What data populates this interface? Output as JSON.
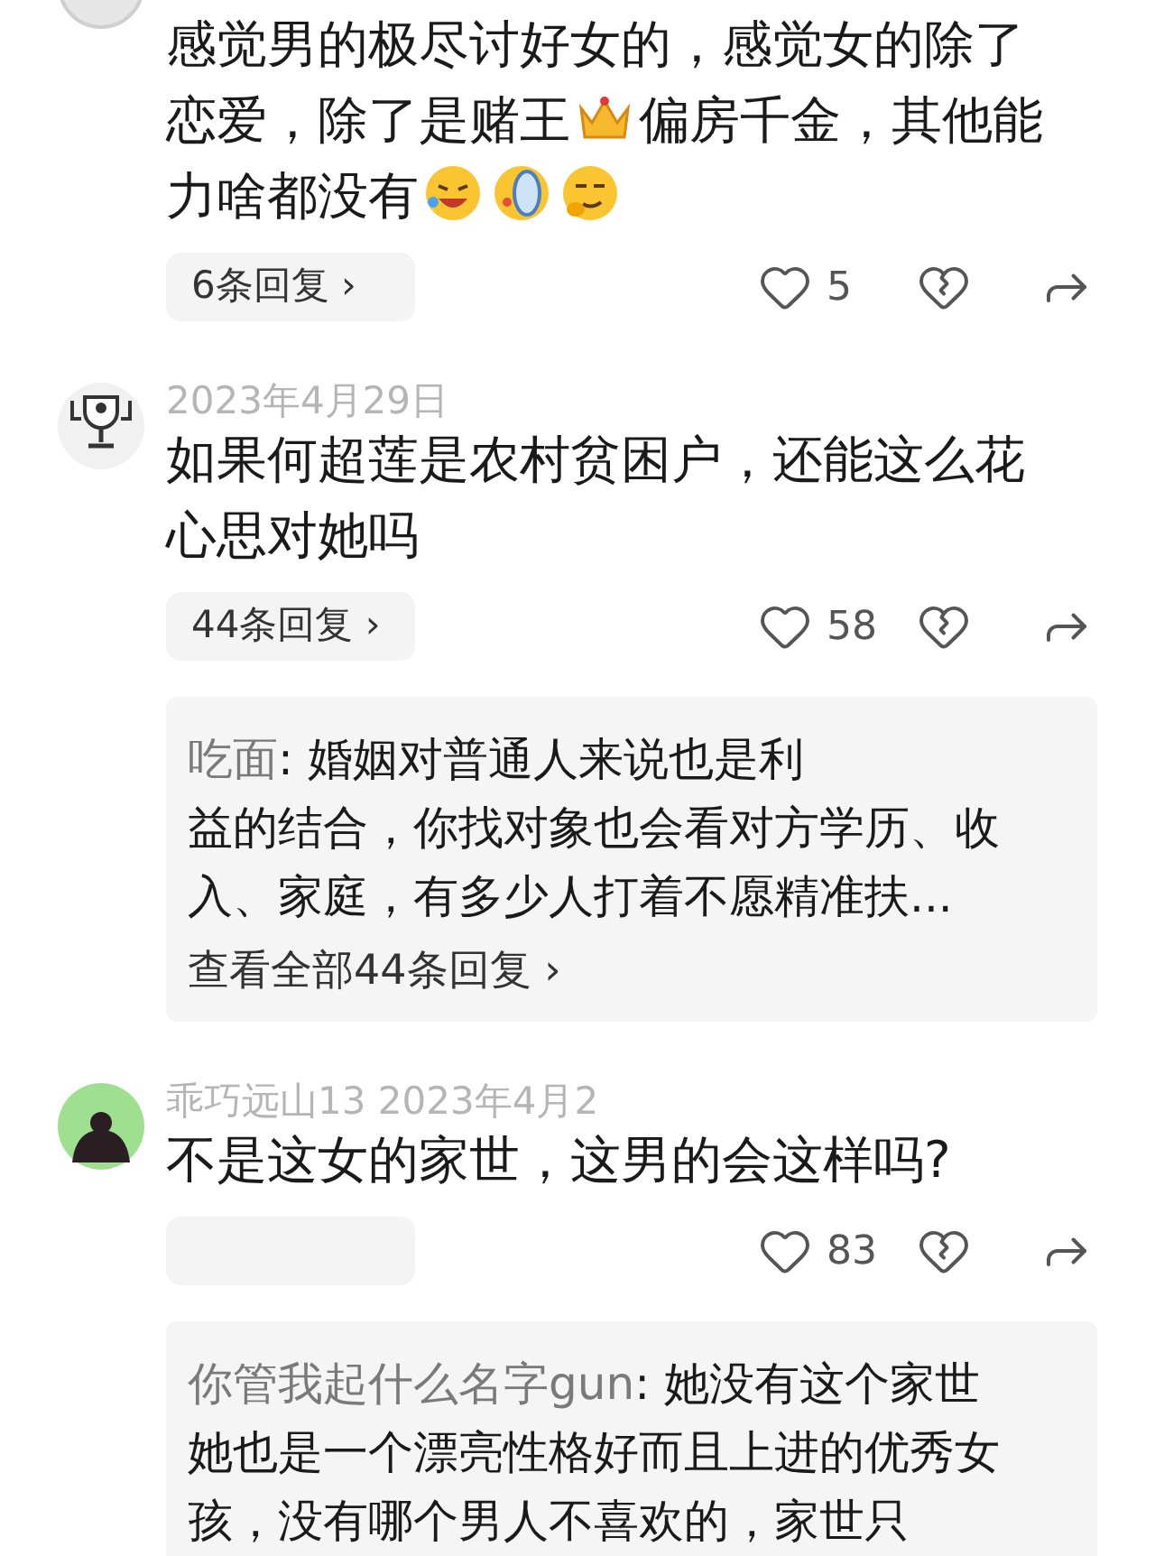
{
  "comments": [
    {
      "avatar": {
        "kind": "plain"
      },
      "lines": [
        [
          {
            "kind": "text",
            "text": "感觉男的极尽讨好女的，感觉女的除了"
          }
        ],
        [
          {
            "kind": "text",
            "text": "恋爱，除了是赌王"
          },
          {
            "kind": "crown"
          },
          {
            "kind": "text",
            "text": "偏房千金，其他能"
          }
        ],
        [
          {
            "kind": "text",
            "text": "力啥都没有"
          },
          {
            "kind": "laugh"
          },
          {
            "kind": "slipper"
          },
          {
            "kind": "smug"
          }
        ]
      ],
      "replies_label": "6条回复 ›",
      "likes": "5"
    },
    {
      "avatar": {
        "kind": "trophy"
      },
      "header": "2023年4月29日",
      "lines": [
        [
          {
            "kind": "text",
            "text": "如果何超莲是农村贫困户，还能这么花"
          }
        ],
        [
          {
            "kind": "text",
            "text": "心思对她吗"
          }
        ]
      ],
      "replies_label": "44条回复 ›",
      "likes": "58",
      "reply": {
        "author": "吃面",
        "lines": [
          ": 婚姻对普通人来说也是利",
          "益的结合，你找对象也会看对方学历、收",
          "入、家庭，有多少人打着不愿精准扶..."
        ],
        "more": "查看全部44条回复 ›"
      }
    },
    {
      "avatar": {
        "kind": "figure"
      },
      "header": "乖巧远山13  2023年4月2",
      "lines": [
        [
          {
            "kind": "text",
            "text": "不是这女的家世，这男的会这样吗?"
          }
        ]
      ],
      "likes": "83",
      "reply": {
        "author": "你管我起什么名字gun",
        "lines": [
          ": 她没有这个家世",
          "她也是一个漂亮性格好而且上进的优秀女",
          "孩，没有哪个男人不喜欢的，家世只"
        ]
      }
    }
  ]
}
